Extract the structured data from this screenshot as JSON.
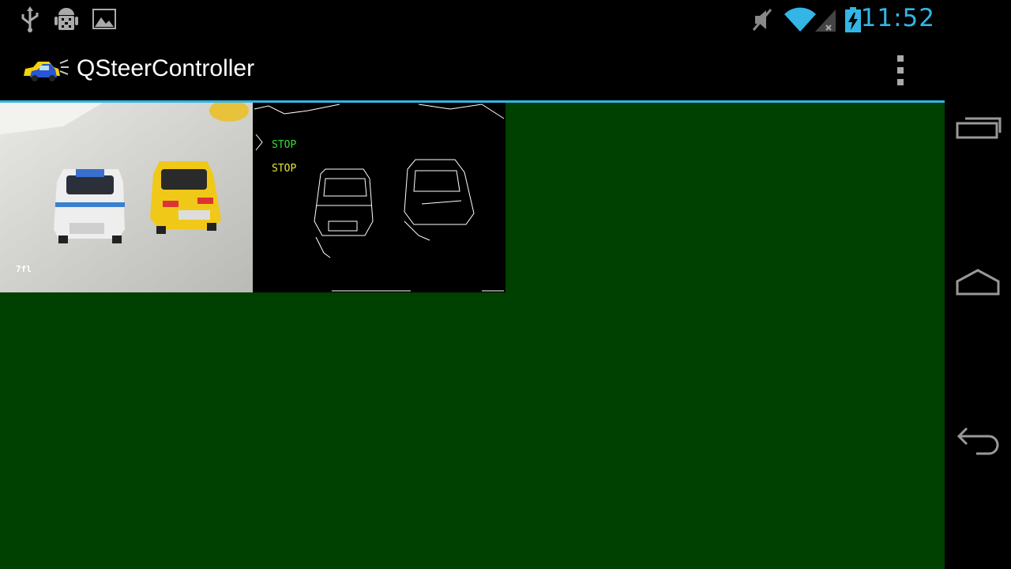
{
  "status": {
    "time": "11:52"
  },
  "app": {
    "title": "QSteerController"
  },
  "camera": {
    "fps_text": "7fl",
    "labels": [
      {
        "text": "STOP",
        "color": "#33dd33"
      },
      {
        "text": "STOP",
        "color": "#e6e633"
      }
    ]
  },
  "colors": {
    "accent": "#33b5e5",
    "content_bg": "#004000"
  }
}
